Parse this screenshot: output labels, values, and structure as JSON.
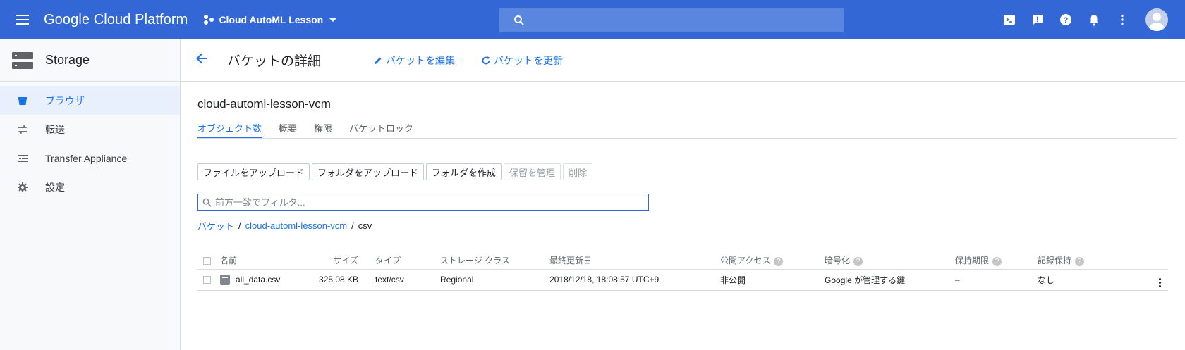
{
  "topbar": {
    "product_name": "Google Cloud Platform",
    "project_name": "Cloud AutoML Lesson",
    "colors": {
      "bar": "#3367d6",
      "search": "#5a86e0"
    }
  },
  "sidebar": {
    "title": "Storage",
    "items": [
      {
        "label": "ブラウザ",
        "icon": "bucket-icon",
        "active": true
      },
      {
        "label": "転送",
        "icon": "transfer-icon",
        "active": false
      },
      {
        "label": "Transfer Appliance",
        "icon": "list-icon",
        "active": false
      },
      {
        "label": "設定",
        "icon": "gear-icon",
        "active": false
      }
    ]
  },
  "page": {
    "title": "バケットの詳細",
    "edit_label": "バケットを編集",
    "refresh_label": "バケットを更新"
  },
  "bucket": {
    "name": "cloud-automl-lesson-vcm",
    "tabs": [
      "オブジェクト数",
      "概要",
      "権限",
      "バケットロック"
    ],
    "active_tab": 0
  },
  "actions": {
    "upload_files": "ファイルをアップロード",
    "upload_folder": "フォルダをアップロード",
    "create_folder": "フォルダを作成",
    "manage_holds": "保留を管理",
    "delete": "削除"
  },
  "filter": {
    "placeholder": "前方一致でフィルタ..."
  },
  "breadcrumb": {
    "root": "バケット",
    "bucket": "cloud-automl-lesson-vcm",
    "current": "csv"
  },
  "table": {
    "headers": {
      "name": "名前",
      "size": "サイズ",
      "type": "タイプ",
      "storage_class": "ストレージ クラス",
      "updated": "最終更新日",
      "public_access": "公開アクセス",
      "encryption": "暗号化",
      "retention": "保持期限",
      "hold": "記録保持"
    },
    "rows": [
      {
        "name": "all_data.csv",
        "size": "325.08 KB",
        "type": "text/csv",
        "storage_class": "Regional",
        "updated": "2018/12/18, 18:08:57 UTC+9",
        "public_access": "非公開",
        "encryption": "Google が管理する鍵",
        "retention": "–",
        "hold": "なし"
      }
    ]
  }
}
